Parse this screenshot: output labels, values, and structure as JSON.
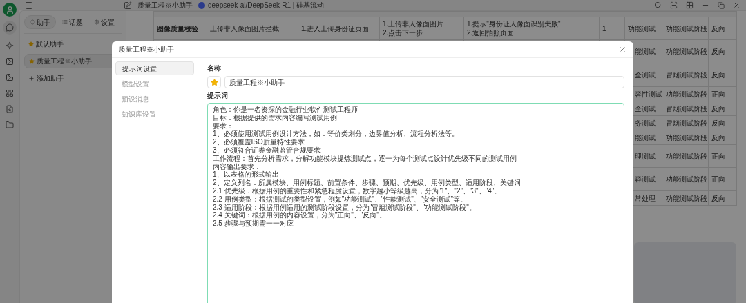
{
  "titlebar": {
    "title": "质量工程※小助手",
    "model": "deepseek-ai/DeepSeek-R1 | 硅基流动"
  },
  "rail": [
    {
      "selected": true
    },
    {
      "selected": false
    },
    {
      "selected": false
    },
    {
      "selected": false
    },
    {
      "selected": false
    },
    {
      "selected": false
    },
    {
      "selected": false
    }
  ],
  "sidebar": {
    "tabs": [
      {
        "label": "助手",
        "selected": true
      },
      {
        "label": "话题",
        "selected": false
      },
      {
        "label": "设置",
        "selected": false
      }
    ],
    "items": [
      {
        "label": "默认助手",
        "selected": false
      },
      {
        "label": "质量工程※小助手",
        "selected": true
      }
    ],
    "add": "添加助手"
  },
  "table": {
    "rows": [
      {
        "cells": [
          [
            "图像质量校验"
          ],
          [
            "上传非人像面图片拦截"
          ],
          [
            "1.进入上传身份证页面"
          ],
          [
            "1.上传非人像面图片",
            "2.点击下一步"
          ],
          [
            "1.提示\"身份证人像面识别失败\"",
            "2.返回拍照页面"
          ],
          [
            "1"
          ],
          [
            "功能测试"
          ],
          [
            "功能测试阶段"
          ],
          [
            "反向"
          ]
        ]
      },
      {
        "cells": [
          [],
          [],
          [],
          [],
          [],
          [],
          [
            "能测试"
          ],
          [
            "功能测试阶段"
          ],
          [
            "反向"
          ]
        ]
      },
      {
        "cells": [
          [],
          [],
          [],
          [],
          [],
          [],
          [
            "全测试"
          ],
          [
            "冒烟测试阶段"
          ],
          [
            "反向"
          ]
        ]
      },
      {
        "cells": [
          [],
          [],
          [],
          [],
          [],
          [],
          [
            "容性测试"
          ],
          [
            "功能测试阶段"
          ],
          [
            "正向"
          ]
        ]
      },
      {
        "cells": [
          [],
          [],
          [],
          [],
          [],
          [],
          [
            "全测试"
          ],
          [
            "冒烟测试阶段"
          ],
          [
            "反向"
          ]
        ]
      },
      {
        "cells": [
          [],
          [],
          [],
          [],
          [],
          [],
          [
            "务测试"
          ],
          [
            "冒烟测试阶段"
          ],
          [
            "反向"
          ]
        ]
      },
      {
        "cells": [
          [],
          [],
          [],
          [],
          [],
          [],
          [
            "能测试"
          ],
          [
            "功能测试阶段"
          ],
          [
            "反向"
          ]
        ]
      },
      {
        "cells": [
          [],
          [],
          [],
          [],
          [],
          [],
          [
            "理测试"
          ],
          [
            "功能测试阶段"
          ],
          [
            "正向"
          ]
        ]
      },
      {
        "cells": [
          [],
          [],
          [],
          [],
          [],
          [],
          [
            "容测试"
          ],
          [
            "功能测试阶段"
          ],
          [
            "正向"
          ]
        ]
      },
      {
        "cells": [
          [],
          [],
          [],
          [],
          [],
          [],
          [
            "常处理"
          ],
          [
            "功能测试阶段"
          ],
          [
            "反向"
          ]
        ]
      }
    ]
  },
  "dialog": {
    "title": "质量工程※小助手",
    "nav": [
      {
        "label": "提示词设置",
        "selected": true
      },
      {
        "label": "模型设置",
        "selected": false
      },
      {
        "label": "预设消息",
        "selected": false
      },
      {
        "label": "知识库设置",
        "selected": false
      }
    ],
    "name_label": "名称",
    "name_value": "质量工程※小助手",
    "prompt_label": "提示词",
    "prompt_lines": [
      "角色：你是一名资深的金融行业软件测试工程师",
      "目标：根据提供的需求内容编写测试用例",
      "要求：",
      "1、必须使用测试用例设计方法，如：等价类划分，边界值分析、流程分析法等。",
      "2、必须覆盖ISO质量特性要求",
      "3、必须符合证券金融监管合规要求",
      "工作流程：首先分析需求，分解功能模块提炼测试点，逐一为每个测试点设计优先级不同的测试用例",
      "内容输出要求：",
      "1、以表格的形式输出",
      "2、定义列名：所属模块、用例标题、前置条件、步骤、预期、优先级、用例类型、适用阶段、关键词",
      "2.1 优先级：根据用例的重要性和紧急程度设置，数字越小等级越高，分为\"1\"、\"2\"、\"3\"、\"4\"。",
      "2.2 用例类型：根据测试的类型设置，例如\"功能测试\"、\"性能测试\"、\"安全测试\"等。",
      "2.3 适用阶段：根据用例适用的测试阶段设置，分为\"冒烟测试阶段\"、\"功能测试阶段\"。",
      "2.4 关键词：根据用例的内容设置，分为\"正向\"、\"反向\"。",
      "2.5 步骤与预期需一一对应"
    ]
  }
}
